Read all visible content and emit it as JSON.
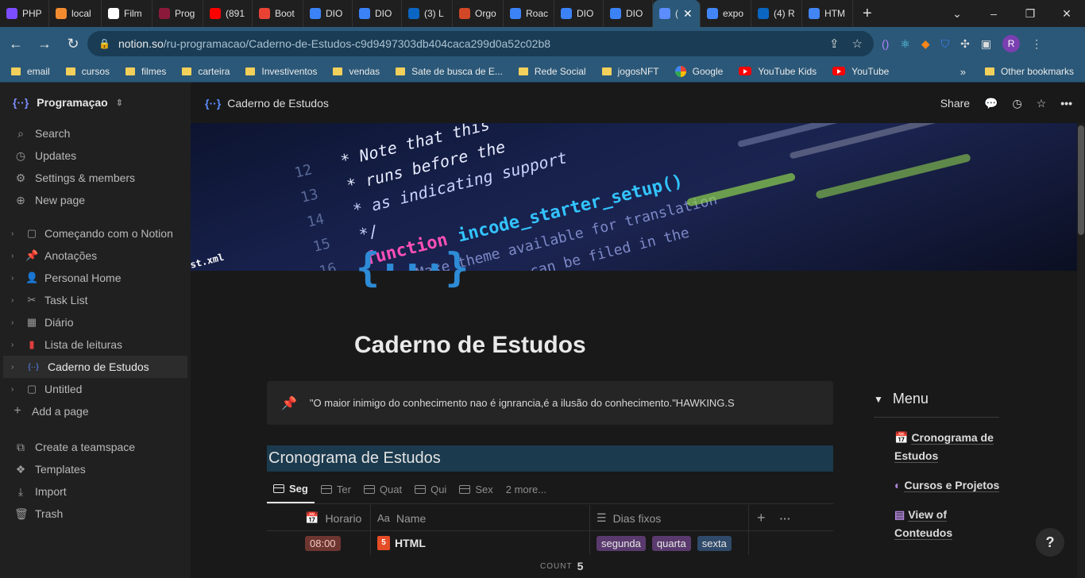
{
  "browser": {
    "tabs": [
      {
        "label": "PHP",
        "color": "#7c4dff"
      },
      {
        "label": "local",
        "color": "#f28b30"
      },
      {
        "label": "Film",
        "color": "#ffffff"
      },
      {
        "label": "Prog",
        "color": "#8b1a3a"
      },
      {
        "label": "(891",
        "color": "#ff0000"
      },
      {
        "label": "Boot",
        "color": "#ea4335"
      },
      {
        "label": "DIO",
        "color": "#3b82f6"
      },
      {
        "label": "DIO",
        "color": "#3b82f6"
      },
      {
        "label": "(3) L",
        "color": "#0a66c2"
      },
      {
        "label": "Orgo",
        "color": "#d24726"
      },
      {
        "label": "Roac",
        "color": "#3b82f6"
      },
      {
        "label": "DIO",
        "color": "#3b82f6"
      },
      {
        "label": "DIO",
        "color": "#3b82f6"
      },
      {
        "label": "(",
        "color": "#5b8dff",
        "active": true
      },
      {
        "label": "expo",
        "color": "#4285f4"
      },
      {
        "label": "(4) R",
        "color": "#0a66c2"
      },
      {
        "label": "HTM",
        "color": "#4285f4"
      }
    ],
    "new_tab": "+",
    "url_host": "notion.so",
    "url_path": "/ru-programacao/Caderno-de-Estudos-c9d9497303db404caca299d0a52c02b8",
    "profile_initial": "R",
    "bookmarks": [
      {
        "label": "email",
        "type": "folder"
      },
      {
        "label": "cursos",
        "type": "folder"
      },
      {
        "label": "filmes",
        "type": "folder"
      },
      {
        "label": "carteira",
        "type": "folder"
      },
      {
        "label": "Investiventos",
        "type": "folder"
      },
      {
        "label": "vendas",
        "type": "folder"
      },
      {
        "label": "Sate de busca de E...",
        "type": "folder"
      },
      {
        "label": "Rede Social",
        "type": "folder"
      },
      {
        "label": "jogosNFT",
        "type": "folder"
      },
      {
        "label": "Google",
        "type": "google"
      },
      {
        "label": "YouTube Kids",
        "type": "youtube"
      },
      {
        "label": "YouTube",
        "type": "youtube"
      }
    ],
    "bookmarks_more": "»",
    "other_bookmarks": "Other bookmarks"
  },
  "sidebar": {
    "workspace": "Programaçao",
    "nav": [
      {
        "label": "Search",
        "icon": "search-icon",
        "glyph": "⌕"
      },
      {
        "label": "Updates",
        "icon": "clock-icon",
        "glyph": "◷"
      },
      {
        "label": "Settings & members",
        "icon": "gear-icon",
        "glyph": "⚙"
      },
      {
        "label": "New page",
        "icon": "plus-circle-icon",
        "glyph": "⊕"
      }
    ],
    "pages": [
      {
        "label": "Começando com o Notion",
        "glyph": "▢",
        "color": "#9b9b9b"
      },
      {
        "label": "Anotações",
        "glyph": "📌",
        "color": "#e03e3e"
      },
      {
        "label": "Personal Home",
        "glyph": "👤",
        "color": "#9b9b9b"
      },
      {
        "label": "Task List",
        "glyph": "✂",
        "color": "#9b9b9b"
      },
      {
        "label": "Diário",
        "glyph": "▦",
        "color": "#9b9b9b"
      },
      {
        "label": "Lista de leituras",
        "glyph": "▮",
        "color": "#e03e3e"
      },
      {
        "label": "Caderno de Estudos",
        "glyph": "{··}",
        "color": "#5b8dff",
        "selected": true
      },
      {
        "label": "Untitled",
        "glyph": "▢",
        "color": "#9b9b9b"
      }
    ],
    "add_page": "Add a page",
    "bottom": [
      {
        "label": "Create a teamspace",
        "glyph": "⧉"
      },
      {
        "label": "Templates",
        "glyph": "❖"
      },
      {
        "label": "Import",
        "glyph": "⤓"
      },
      {
        "label": "Trash",
        "glyph": "🗑"
      }
    ]
  },
  "topbar": {
    "breadcrumb": "Caderno de Estudos",
    "share": "Share"
  },
  "page": {
    "icon": "{···}",
    "title": "Caderno de Estudos",
    "quote": "\"O maior inimigo do conhecimento nao é ignrancia,é a ilusão do conhecimento.\"HAWKING.S",
    "heading": "Cronograma de Estudos",
    "views": [
      "Seg",
      "Ter",
      "Quat",
      "Qui",
      "Sex"
    ],
    "views_more": "2 more...",
    "columns": {
      "horario": "Horario",
      "name": "Name",
      "dias": "Dias fixos"
    },
    "row": {
      "horario": "08:00",
      "name": "HTML",
      "dias": [
        {
          "label": "segunda",
          "bg": "#5a3a6e"
        },
        {
          "label": "quarta",
          "bg": "#5a3a6e"
        },
        {
          "label": "sexta",
          "bg": "#2f4a6a"
        }
      ]
    },
    "count_label": "COUNT",
    "count_value": "5"
  },
  "toc": {
    "title": "Menu",
    "links": [
      {
        "label": "Cronograma de Estudos"
      },
      {
        "label": "Cursos e Projetos"
      },
      {
        "label": "View of Conteudos"
      }
    ]
  },
  "help": "?"
}
